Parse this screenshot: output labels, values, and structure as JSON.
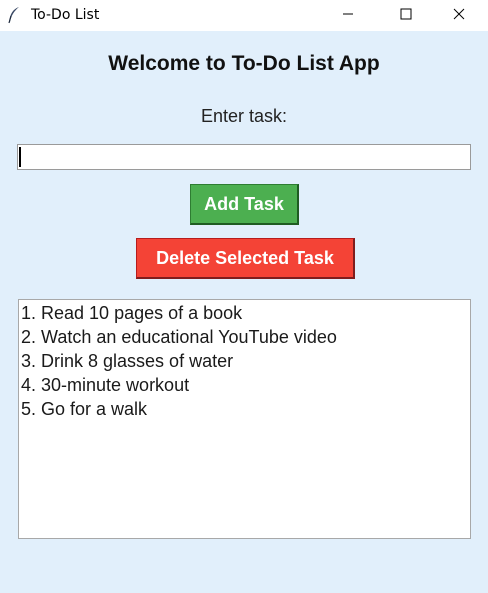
{
  "window": {
    "title": "To-Do List",
    "icon": "feather-icon"
  },
  "main": {
    "heading": "Welcome to To-Do List App",
    "prompt_label": "Enter task:",
    "task_input": {
      "value": "",
      "placeholder": ""
    },
    "add_button_label": "Add Task",
    "delete_button_label": "Delete Selected Task",
    "tasks": [
      "1. Read 10 pages of a book",
      "2. Watch an educational YouTube video",
      "3. Drink 8 glasses of water",
      "4. 30-minute workout",
      "5. Go for a walk"
    ]
  },
  "colors": {
    "background": "#e1effb",
    "add_button": "#4caf50",
    "delete_button": "#f44336"
  }
}
